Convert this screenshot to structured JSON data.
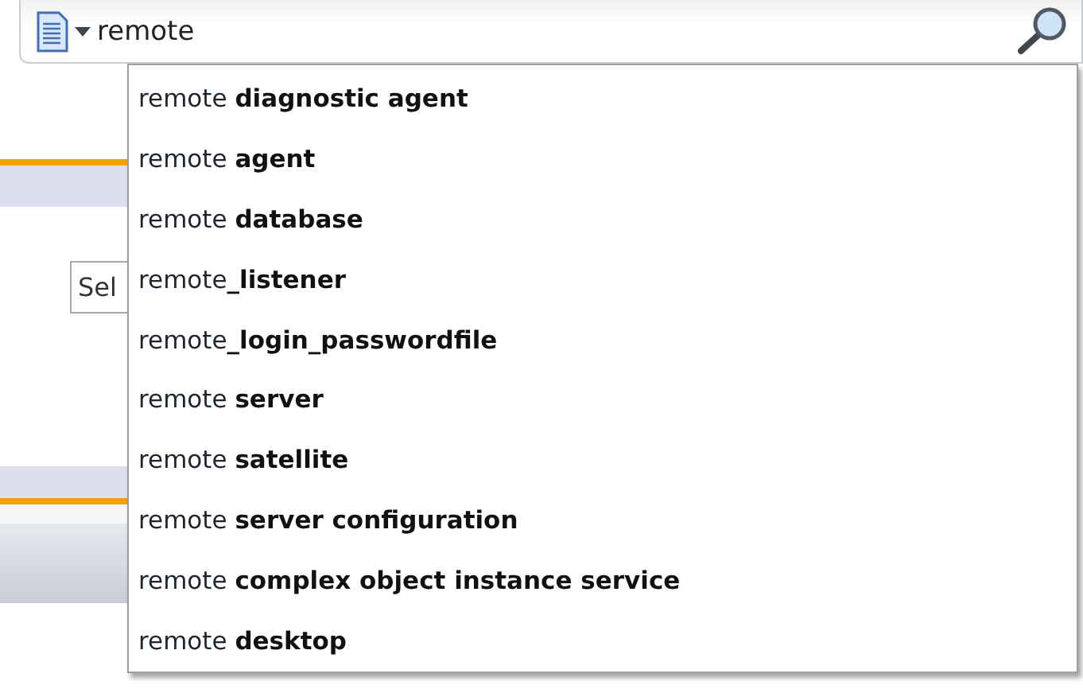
{
  "search_bar": {
    "value": "remote"
  },
  "background": {
    "select": {
      "value": "Sel"
    }
  },
  "suggestions": [
    {
      "text": "remote **diagnostic agent**"
    },
    {
      "text": "remote **agent**"
    },
    {
      "text": "remote **database**"
    },
    {
      "text": "remote**_listener**"
    },
    {
      "text": "remote**_login_passwordfile**"
    },
    {
      "text": "remote **server**"
    },
    {
      "text": "remote **satellite**"
    },
    {
      "text": "remote **server configuration**"
    },
    {
      "text": "remote **complex object instance service**"
    },
    {
      "text": "remote **desktop**"
    }
  ]
}
